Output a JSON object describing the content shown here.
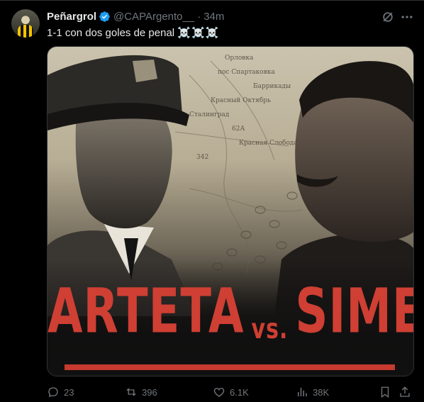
{
  "author": {
    "display_name": "Peñargrol",
    "handle": "@CAPArgento__",
    "time_separator": "·",
    "time": "34m"
  },
  "tweet": {
    "text": "1-1 con dos goles de penal",
    "emoji": "☠️☠️☠️"
  },
  "media": {
    "title_left": "ARTETA",
    "title_vs": "vs.",
    "title_right": "SIMEONE",
    "map_labels": [
      "Орловка",
      "пос Спартаковка",
      "Баррикады",
      "Красный Октябрь",
      "Сталинград",
      "Красная Слобода",
      "62А",
      "342"
    ]
  },
  "actions": {
    "replies": "23",
    "reposts": "396",
    "likes": "6.1K",
    "views": "38K"
  },
  "colors": {
    "verified": "#1d9bf0",
    "title_red": "#cf3f33",
    "muted": "#71767b",
    "text": "#e7e9ea",
    "background": "#000000"
  }
}
